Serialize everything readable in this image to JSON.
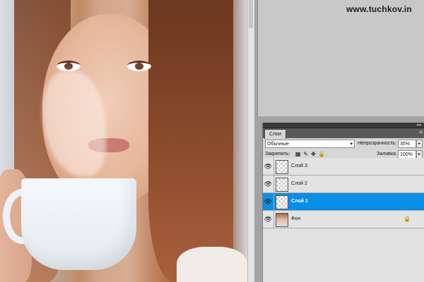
{
  "watermark": "www.tuchkov.in",
  "panel": {
    "tab_label": "Слои",
    "blend_mode": "Обычные",
    "opacity_label": "Непрозрачность:",
    "opacity_value": "35%",
    "lock_label": "Закрепить:",
    "fill_label": "Заливка:",
    "fill_value": "100%"
  },
  "layers": [
    {
      "name": "Слой 3",
      "active": false
    },
    {
      "name": "Слой 2",
      "active": false
    },
    {
      "name": "Слой 1",
      "active": true
    },
    {
      "name": "Фон",
      "active": false,
      "locked": true
    }
  ],
  "colors": {
    "selection": "#0a8fe6"
  }
}
